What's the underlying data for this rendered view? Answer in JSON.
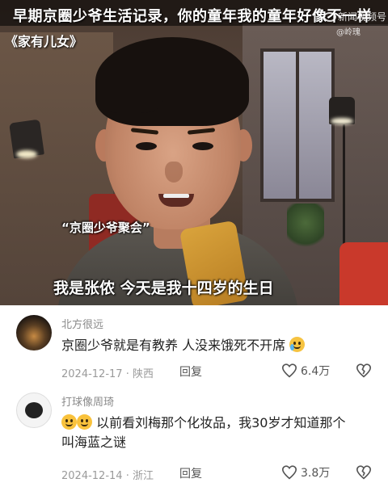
{
  "video": {
    "title": "早期京圈少爷生活记录，你的童年我的童年好像不一样",
    "show_title": "《家有儿女》",
    "watermark_label": "新闻视频号",
    "watermark_handle": "@岭瑰",
    "subtitle_small": "“京圈少爷聚会”",
    "subtitle_main": "我是张侬  今天是我十四岁的生日"
  },
  "comments": [
    {
      "username": "北方很远",
      "text": "京圈少爷就是有教养 人没来饿死不开席",
      "emoji": "crying-laughing",
      "date": "2024-12-17",
      "location": "陕西",
      "reply_label": "回复",
      "likes": "6.4万"
    },
    {
      "username": "打球像周琦",
      "emoji_prefix": [
        "smile",
        "smile"
      ],
      "text": "以前看刘梅那个化妆品，我30岁才知道那个叫海蓝之谜",
      "date": "2024-12-14",
      "location": "浙江",
      "reply_label": "回复",
      "likes": "3.8万"
    }
  ]
}
